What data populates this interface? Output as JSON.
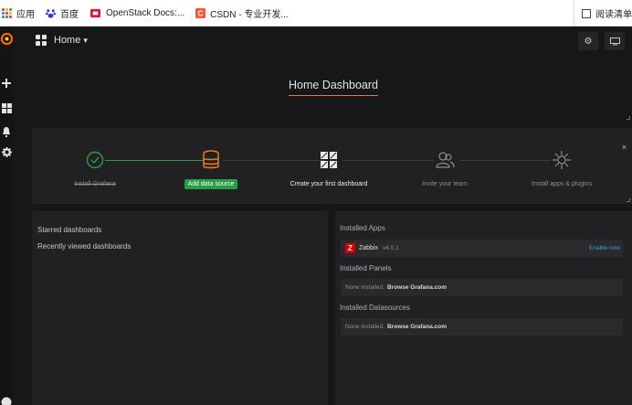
{
  "browser": {
    "bookmarks": [
      {
        "label": "应用",
        "icon": "apps-grid-icon"
      },
      {
        "label": "百度",
        "icon": "baidu-paw-icon"
      },
      {
        "label": "OpenStack Docs:...",
        "icon": "openstack-icon"
      },
      {
        "label": "CSDN - 专业开发...",
        "icon": "csdn-icon"
      }
    ],
    "reading_list": "阅读清单"
  },
  "sidebar": {
    "icons": [
      "grafana-logo-icon",
      "plus-icon",
      "dashboards-grid-icon",
      "alert-bell-icon",
      "gear-icon"
    ]
  },
  "navbar": {
    "title": "Home",
    "caret": "▾",
    "settings_icon": "⚙",
    "tv_icon": "▭"
  },
  "dashboard": {
    "title": "Home Dashboard"
  },
  "getting_started": {
    "close": "×",
    "steps": [
      {
        "label": "Install Grafana",
        "state": "done",
        "color": "#299c46"
      },
      {
        "label": "Add data source",
        "state": "active",
        "color": "#eb7b18"
      },
      {
        "label": "Create your first dashboard",
        "state": "next",
        "color": "#ececec"
      },
      {
        "label": "Invite your team",
        "state": "todo",
        "color": "#8e8e8e"
      },
      {
        "label": "Install apps & plugins",
        "state": "todo",
        "color": "#8e8e8e"
      }
    ]
  },
  "lists": {
    "starred": "Starred dashboards",
    "recent": "Recently viewed dashboards"
  },
  "plugins": {
    "apps_heading": "Installed Apps",
    "app": {
      "logo": "Z",
      "name": "Zabbix",
      "version": "v4.0.1",
      "action": "Enable now"
    },
    "panels_heading": "Installed Panels",
    "panels_none": "None installed.",
    "panels_browse": "Browse Grafana.com",
    "datasources_heading": "Installed Datasources",
    "datasources_none": "None installed.",
    "datasources_browse": "Browse Grafana.com"
  },
  "colors": {
    "accent": "#eb7b18",
    "success": "#299c46",
    "link": "#33a2e5"
  }
}
